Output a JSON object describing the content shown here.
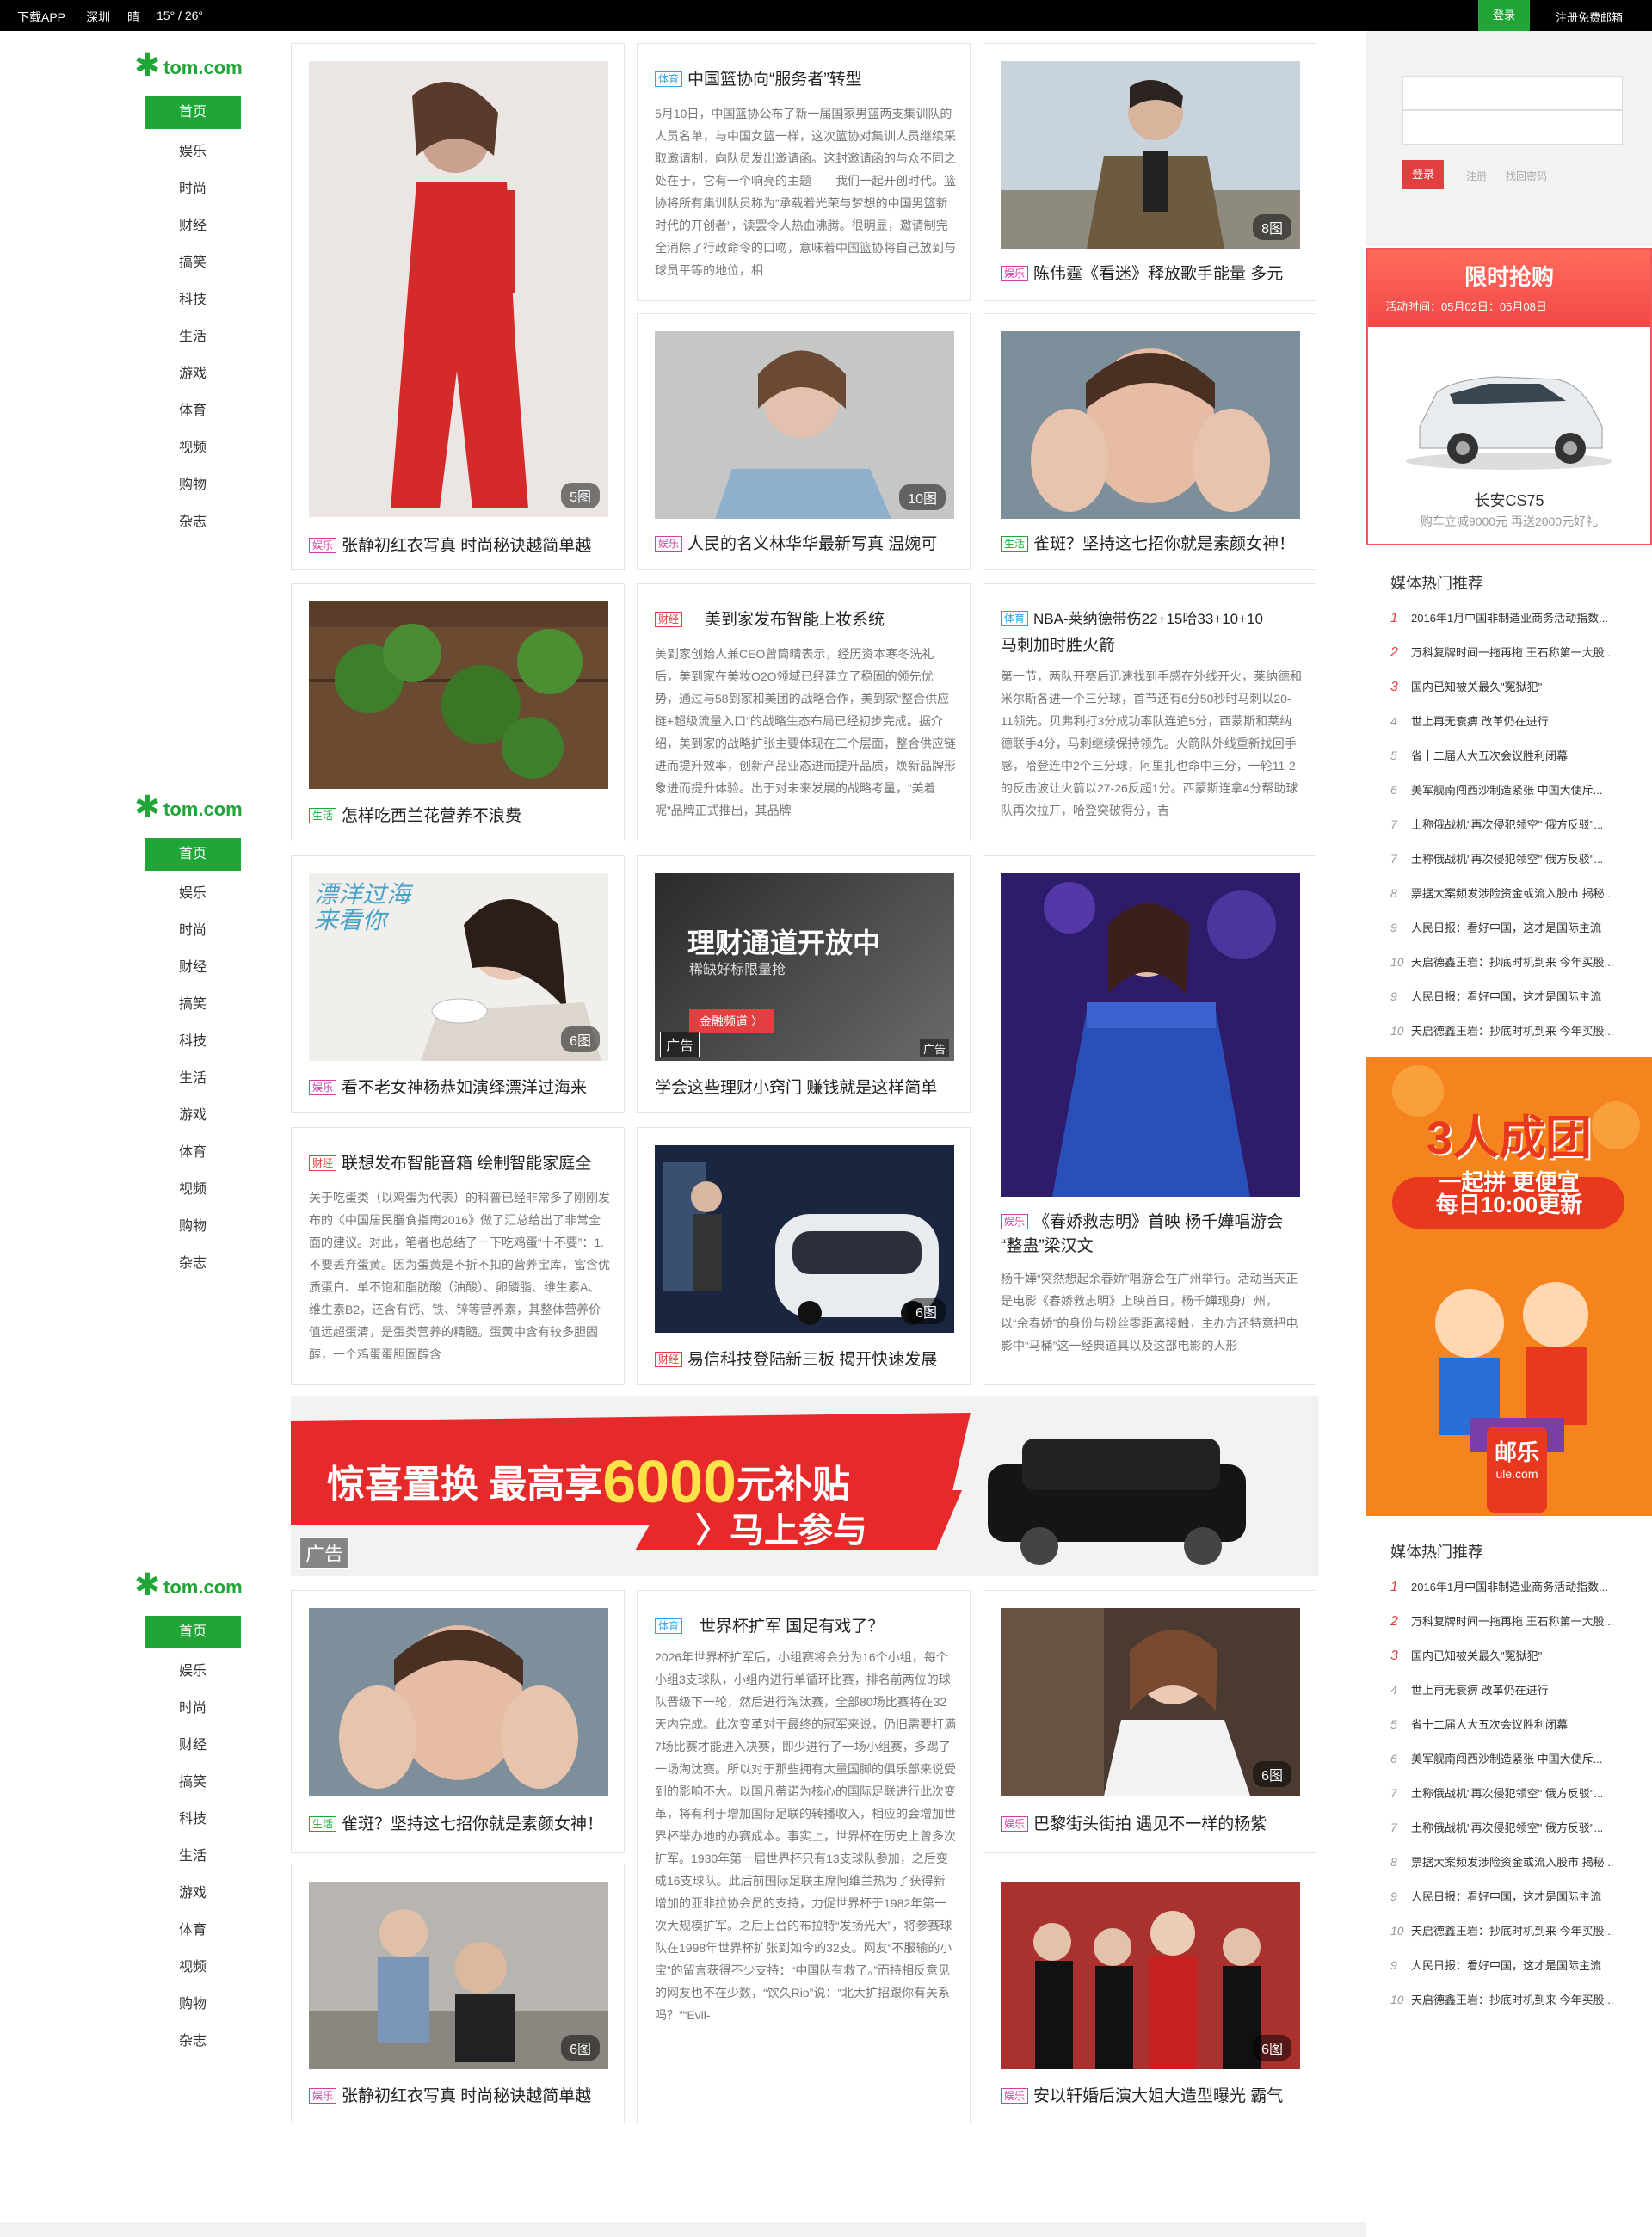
{
  "topbar": {
    "download": "下载APP",
    "city": "深圳",
    "weather": "晴",
    "temp": "15° / 26°",
    "login": "登录",
    "register": "注册免费邮箱"
  },
  "logo": {
    "text": "tom.com"
  },
  "nav": [
    "首页",
    "娱乐",
    "时尚",
    "财经",
    "搞笑",
    "科技",
    "生活",
    "游戏",
    "体育",
    "视频",
    "购物",
    "杂志"
  ],
  "cards": {
    "c1": {
      "tag": "娱乐",
      "title": "张静初红衣写真 时尚秘诀越简单越",
      "count": "5图"
    },
    "c2": {
      "tag": "体育",
      "title": "中国篮协向“服务者”转型",
      "body": "5月10日，中国篮协公布了新一届国家男篮两支集训队的人员名单，与中国女篮一样，这次篮协对集训人员继续采取邀请制，向队员发出邀请函。这封邀请函的与众不同之处在于，它有一个响亮的主题——我们一起开创时代。篮协将所有集训队员称为“承载着光荣与梦想的中国男篮新时代的开创者”，读罢令人热血沸腾。很明显，邀请制完全消除了行政命令的口吻，意味着中国篮协将自己放到与球员平等的地位，相"
    },
    "c3": {
      "tag": "娱乐",
      "title": "陈伟霆《看迷》释放歌手能量 多元",
      "count": "8图"
    },
    "c4": {
      "tag": "娱乐",
      "title": "人民的名义林华华最新写真 温婉可",
      "count": "10图"
    },
    "c5": {
      "tag": "生活",
      "title": "雀斑？坚持这七招你就是素颜女神！"
    },
    "c6": {
      "tag": "生活",
      "title": "怎样吃西兰花营养不浪费"
    },
    "c7": {
      "tag": "财经",
      "title": "美到家发布智能上妆系统",
      "body": "美到家创始人兼CEO曾筒晴表示，经历资本寒冬洗礼后，美到家在美妆O2O领域已经建立了稳固的领先优势，通过与58到家和美团的战略合作，美到家“整合供应链+超级流量入口”的战略生态布局已经初步完成。据介绍，美到家的战略扩张主要体现在三个层面，整合供应链进而提升效率，创新产品业态进而提升品质，焕新品牌形象进而提升体验。出于对未来发展的战略考量，“美着呢”品牌正式推出，其品牌"
    },
    "c8": {
      "tag": "体育",
      "title": "NBA-莱纳德带伤22+15哈33+10+10",
      "title2": "马刺加时胜火箭",
      "body": "第一节，两队开赛后迅速找到手感在外线开火，莱纳德和米尔斯各进一个三分球，首节还有6分50秒时马刺以20-11领先。贝弗利打3分成功率队连追5分，西蒙斯和莱纳德联手4分，马刺继续保持领先。火箭队外线重新找回手感，哈登连中2个三分球，阿里扎也命中三分，一轮11-2的反击波让火箭以27-26反超1分。西蒙斯连拿4分帮助球队再次拉开，哈登突破得分，吉"
    },
    "c9": {
      "tag": "娱乐",
      "title": "看不老女神杨恭如演绎漂洋过海来",
      "count": "6图",
      "overlay": "漂洋过海 来看你"
    },
    "c10": {
      "title": "学会这些理财小窍门 赚钱就是这样简单",
      "ad_title": "理财通道开放中",
      "ad_sub": "稀缺好标限量抢",
      "ad_btn": "金融频道 〉",
      "ad_tag": "广告",
      "ad_tag2": "广告"
    },
    "c11": {
      "tag": "娱乐",
      "title": "《春娇救志明》首映 杨千嬅唱游会",
      "title2": "“整蛊”梁汉文",
      "body": "杨千嬅“突然想起余春娇”唱游会在广州举行。活动当天正是电影《春娇救志明》上映首日，杨千嬅现身广州，以“余春娇”的身份与粉丝零距离接触，主办方还特意把电影中“马桶”这一经典道具以及这部电影的人形"
    },
    "c12": {
      "tag": "财经",
      "title": "联想发布智能音箱 绘制智能家庭全",
      "body": "关于吃蛋类（以鸡蛋为代表）的科普已经非常多了刚刚发布的《中国居民膳食指南2016》做了汇总给出了非常全面的建议。对此，笔者也总结了一下吃鸡蛋“十不要”：1.不要丢弃蛋黄。因为蛋黄是不折不扣的营养宝库，富含优质蛋白、单不饱和脂肪酸（油酸）、卵磷脂、维生素A、维生素B2，还含有钙、铁、锌等营养素，其整体营养价值远超蛋清，是蛋类营养的精髓。蛋黄中含有较多胆固醇，一个鸡蛋蛋胆固醇含"
    },
    "c13": {
      "tag": "财经",
      "title": "易信科技登陆新三板 揭开快速发展",
      "count": "6图"
    },
    "c14": {
      "tag": "生活",
      "title": "雀斑？坚持这七招你就是素颜女神！"
    },
    "c15": {
      "tag": "体育",
      "title": "世界杯扩军 国足有戏了？",
      "body": "2026年世界杯扩军后，小组赛将会分为16个小组，每个小组3支球队，小组内进行单循环比赛，排名前两位的球队晋级下一轮，然后进行淘汰赛，全部80场比赛将在32天内完成。此次变革对于最终的冠军来说，仍旧需要打满7场比赛才能进入决赛，即少进行了一场小组赛，多踢了一场淘汰赛。所以对于那些拥有大量国脚的俱乐部来说受到的影响不大。以国凡蒂诺为核心的国际足联进行此次变革，将有利于增加国际足联的转播收入，相应的会增加世界杯举办地的办赛成本。事实上，世界杯在历史上曾多次扩军。1930年第一届世界杯只有13支球队参加，之后变成16支球队。此后前国际足联主席阿维兰热为了获得新增加的亚非拉协会员的支持，力促世界杯于1982年第一次大规模扩军。之后上台的布拉特“发扬光大”，将参赛球队在1998年世界杯扩张到如今的32支。网友“不服输的小宝”的留言获得不少支持：“中国队有救了。”而持相反意见的网友也不在少数，“饮久Rio”说：“北大扩招跟你有关系吗？”“Evil-"
    },
    "c16": {
      "tag": "娱乐",
      "title": "巴黎街头街拍 遇见不一样的杨紫",
      "count": "6图"
    },
    "c17": {
      "tag": "娱乐",
      "title": "张静初红衣写真 时尚秘诀越简单越",
      "count": "6图"
    },
    "c18": {
      "tag": "娱乐",
      "title": "安以轩婚后演大姐大造型曝光 霸气",
      "count": "6图"
    }
  },
  "banner": {
    "main": "惊喜置换 最高享",
    "amount": "6000",
    "unit": "元补贴",
    "cta": "马上参与",
    "ad": "广告"
  },
  "loginbox": {
    "login": "登录",
    "register": "注册",
    "forgot": "找回密码"
  },
  "flash": {
    "title": "限时抢购",
    "time": "活动时间：05月02日：05月08日",
    "car_name": "长安CS75",
    "car_desc": "购车立减9000元 再送2000元好礼"
  },
  "hot": {
    "heading": "媒体热门推荐",
    "items": [
      {
        "n": "1",
        "t": "2016年1月中国非制造业商务活动指数..."
      },
      {
        "n": "2",
        "t": "万科复牌时间一拖再拖 王石称第一大股..."
      },
      {
        "n": "3",
        "t": "国内已知被关最久\"冤狱犯\""
      },
      {
        "n": "4",
        "t": "世上再无衰痹 改革仍在进行"
      },
      {
        "n": "5",
        "t": "省十二届人大五次会议胜利闭幕"
      },
      {
        "n": "6",
        "t": "美军舰南闯西沙制造紧张 中国大使斥..."
      },
      {
        "n": "7",
        "t": "土称俄战机\"再次侵犯领空\" 俄方反驳\"..."
      },
      {
        "n": "7",
        "t": "土称俄战机\"再次侵犯领空\" 俄方反驳\"..."
      },
      {
        "n": "8",
        "t": "票据大案频发涉险资金或流入股市 揭秘..."
      },
      {
        "n": "9",
        "t": "人民日报：看好中国，这才是国际主流"
      },
      {
        "n": "10",
        "t": "天启德鑫王岩：抄底时机到来 今年买股..."
      },
      {
        "n": "9",
        "t": "人民日报：看好中国，这才是国际主流"
      },
      {
        "n": "10",
        "t": "天启德鑫王岩：抄底时机到来 今年买股..."
      }
    ]
  },
  "promo": {
    "title": "3人成团",
    "sub": "一起拼 更便宜",
    "time": "每日10:00更新",
    "brand": "邮乐",
    "brand_url": "ule.com"
  },
  "colors": {
    "accent": "#20a637",
    "red": "#e24040"
  }
}
